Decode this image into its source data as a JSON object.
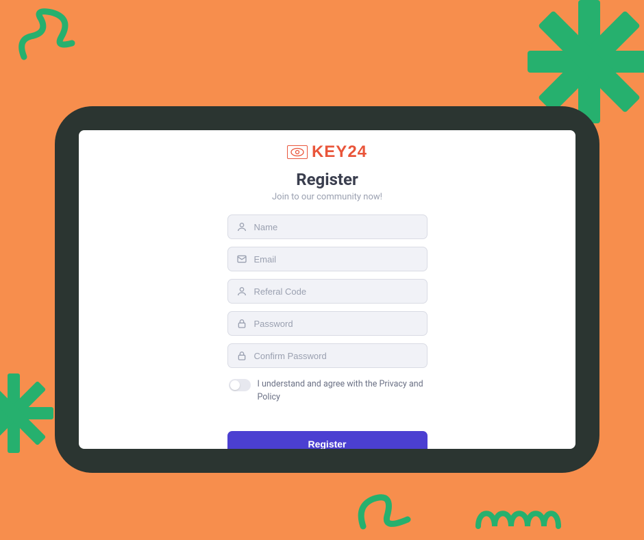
{
  "logo": {
    "text": "KEY24"
  },
  "header": {
    "title": "Register",
    "subtitle": "Join to our community now!"
  },
  "form": {
    "name_placeholder": "Name",
    "email_placeholder": "Email",
    "referral_placeholder": "Referal Code",
    "password_placeholder": "Password",
    "confirm_placeholder": "Confirm Password",
    "agree_label": "I understand and agree with the Privacy and Policy",
    "submit_label": "Register"
  },
  "colors": {
    "background": "#F78E4D",
    "accent_green": "#26B06E",
    "frame": "#2B3531",
    "primary_button": "#4B3FD1",
    "logo": "#E9553A"
  }
}
